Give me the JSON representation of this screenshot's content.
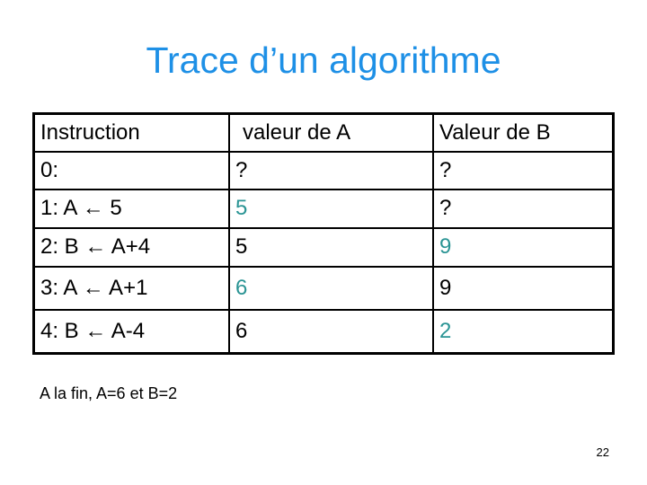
{
  "slide": {
    "title": "Trace d’un algorithme",
    "page_number": "22",
    "conclusion": "A la fin, A=6 et B=2"
  },
  "colors": {
    "title": "#1e90e6",
    "changed_value": "#2a9494",
    "text": "#000000"
  },
  "table": {
    "headers": [
      "Instruction",
      "valeur de A",
      "Valeur de B"
    ],
    "rows": [
      {
        "instruction": "0:",
        "a": "?",
        "b": "?",
        "a_changed": false,
        "b_changed": false
      },
      {
        "instruction": "1: A ← 5",
        "a": "5",
        "b": "?",
        "a_changed": true,
        "b_changed": false
      },
      {
        "instruction": "2: B ← A+4",
        "a": "5",
        "b": "9",
        "a_changed": false,
        "b_changed": true
      },
      {
        "instruction": "3: A ← A+1",
        "a": "6",
        "b": "9",
        "a_changed": true,
        "b_changed": false
      },
      {
        "instruction": "4: B ← A-4",
        "a": "6",
        "b": "2",
        "a_changed": false,
        "b_changed": true
      }
    ]
  }
}
